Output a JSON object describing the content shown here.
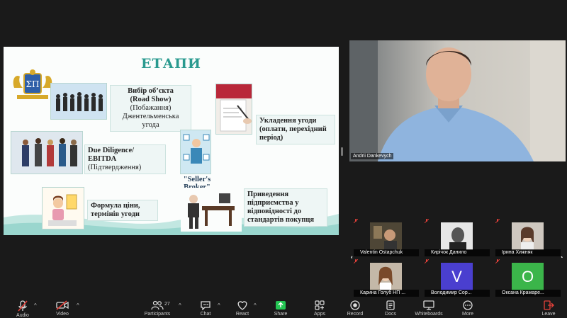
{
  "slide": {
    "title": "ЕТАПИ",
    "steps": {
      "road_show": [
        "Вибір об’єкта",
        "(Road Show)",
        "(Побажання)",
        "Джентельменська угода"
      ],
      "due_diligence": [
        "Due Diligence/",
        "EBITDA",
        "(Підтвердження)"
      ],
      "price": [
        "Формула ціни,",
        "термінів угоди"
      ],
      "agreement": [
        "Укладення угоди",
        "(оплати, перехідний",
        "період)"
      ],
      "adaptation": [
        "Приведення",
        "підприємства у",
        "відповідності до",
        "стандартів покупця"
      ]
    },
    "broker_label": [
      "\"Seller's",
      "Broker\""
    ],
    "logo_letters": "ΣΠ"
  },
  "speaker": {
    "name": "Andrii Dankevych"
  },
  "gallery": {
    "participants": [
      {
        "name": "Valentin Ostapchuk"
      },
      {
        "name": "Кирічок Данило"
      },
      {
        "name": "Ірина Хижняк"
      },
      {
        "name": "Карина Голуб НП ..."
      },
      {
        "name": "Володимир Сор...",
        "initial": "V"
      },
      {
        "name": "Оксана Крамаре...",
        "initial": "O"
      }
    ],
    "colors": {
      "v_avatar": "#4a3fcf",
      "o_avatar": "#3bb54a"
    }
  },
  "toolbar": {
    "audio": "Audio",
    "video": "Video",
    "participants": "Participants",
    "participants_count": "27",
    "chat": "Chat",
    "react": "React",
    "share": "Share",
    "apps": "Apps",
    "record": "Record",
    "docs": "Docs",
    "whiteboards": "Whiteboards",
    "more": "More",
    "leave": "Leave"
  },
  "colors": {
    "accent_teal": "#2a9a8f",
    "share_green": "#23c552",
    "leave_red": "#e5413a"
  }
}
